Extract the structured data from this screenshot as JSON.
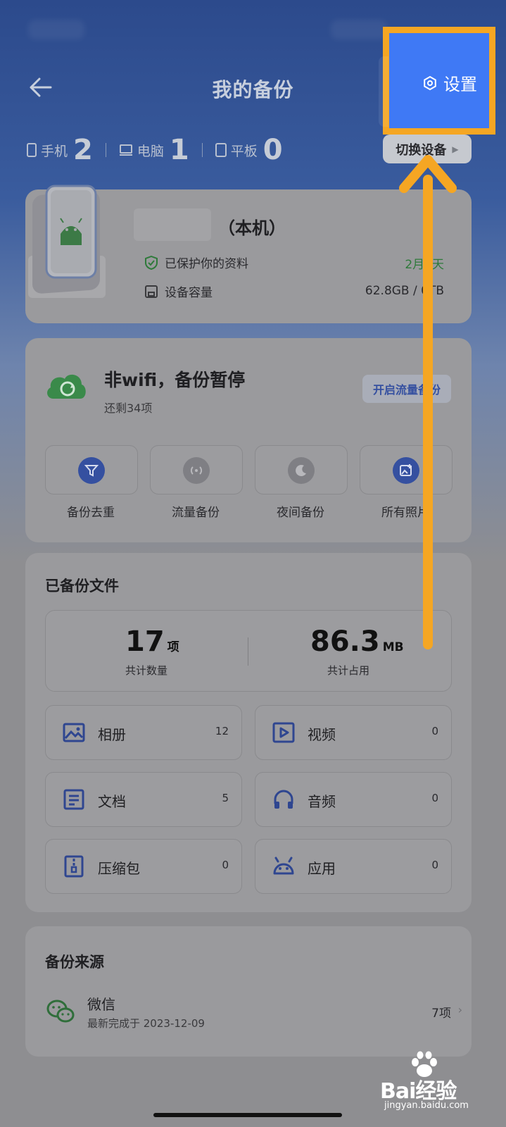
{
  "header": {
    "title": "我的备份",
    "settings_label": "设置"
  },
  "device_counts": [
    {
      "label": "手机",
      "count": "2"
    },
    {
      "label": "电脑",
      "count": "1"
    },
    {
      "label": "平板",
      "count": "0"
    }
  ],
  "switch_device_label": "切换设备",
  "device_card": {
    "local_label": "（本机）",
    "protected_label": "已保护你的资料",
    "protected_value": "2月2天",
    "capacity_label": "设备容量",
    "capacity_value": "62.8GB / 0TB"
  },
  "backup_status": {
    "title": "非wifi，备份暂停",
    "remaining": "还剩34项",
    "enable_button": "开启流量备份"
  },
  "features": [
    {
      "label": "备份去重",
      "icon": "filter-icon"
    },
    {
      "label": "流量备份",
      "icon": "signal-icon"
    },
    {
      "label": "夜间备份",
      "icon": "moon-icon"
    },
    {
      "label": "所有照片",
      "icon": "photo-add-icon"
    }
  ],
  "backed_up": {
    "section_title": "已备份文件",
    "total_count": "17",
    "total_count_unit": "项",
    "total_count_label": "共计数量",
    "total_size": "86.3",
    "total_size_unit": "MB",
    "total_size_label": "共计占用",
    "files": [
      {
        "name": "相册",
        "count": "12",
        "icon": "album-icon"
      },
      {
        "name": "视频",
        "count": "0",
        "icon": "video-icon"
      },
      {
        "name": "文档",
        "count": "5",
        "icon": "document-icon"
      },
      {
        "name": "音频",
        "count": "0",
        "icon": "headphones-icon"
      },
      {
        "name": "压缩包",
        "count": "0",
        "icon": "zip-icon"
      },
      {
        "name": "应用",
        "count": "0",
        "icon": "android-icon"
      }
    ]
  },
  "sources": {
    "section_title": "备份来源",
    "items": [
      {
        "name": "微信",
        "subtitle": "最新完成于 2023-12-09",
        "count": "7项"
      }
    ]
  },
  "watermark": {
    "main": "Bai经验",
    "sub": "jingyan.baidu.com"
  },
  "colors": {
    "highlight_border": "#f5a623",
    "settings_bg": "#3f79f5",
    "accent_blue": "#3550a0",
    "protected_green": "#2e7a3a"
  }
}
